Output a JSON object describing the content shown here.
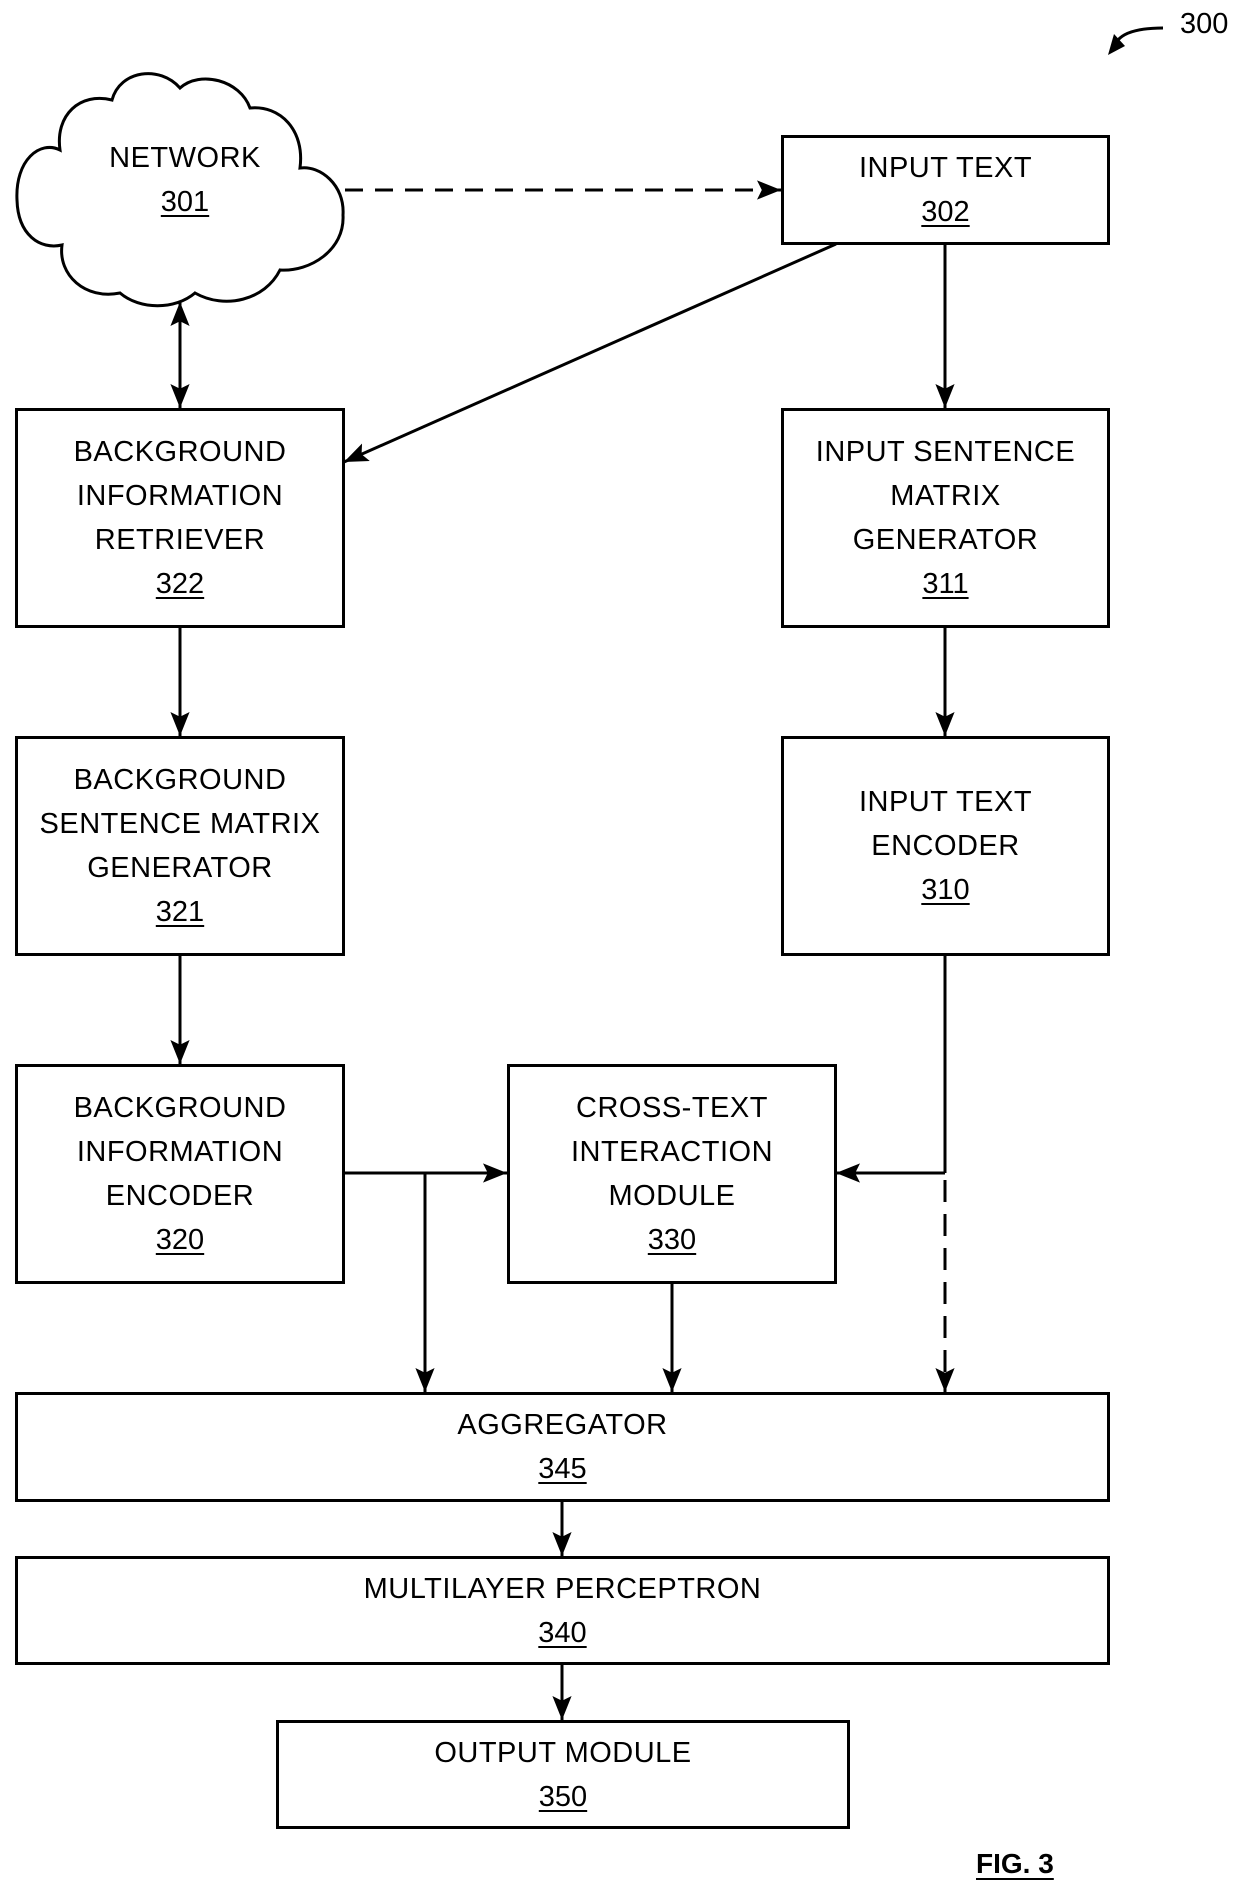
{
  "figure": {
    "reference_number": "300",
    "caption": "FIG. 3"
  },
  "nodes": {
    "network": {
      "label": "NETWORK",
      "ref": "301",
      "shape": "cloud"
    },
    "input_text": {
      "label": "INPUT TEXT",
      "ref": "302"
    },
    "background_information_retriever": {
      "label": "BACKGROUND\nINFORMATION\nRETRIEVER",
      "ref": "322"
    },
    "input_sentence_matrix_generator": {
      "label": "INPUT SENTENCE\nMATRIX\nGENERATOR",
      "ref": "311"
    },
    "background_sentence_matrix_generator": {
      "label": "BACKGROUND\nSENTENCE MATRIX\nGENERATOR",
      "ref": "321"
    },
    "input_text_encoder": {
      "label": "INPUT TEXT\nENCODER",
      "ref": "310"
    },
    "background_information_encoder": {
      "label": "BACKGROUND\nINFORMATION\nENCODER",
      "ref": "320"
    },
    "cross_text_interaction_module": {
      "label": "CROSS-TEXT\nINTERACTION\nMODULE",
      "ref": "330"
    },
    "aggregator": {
      "label": "AGGREGATOR",
      "ref": "345"
    },
    "multilayer_perceptron": {
      "label": "MULTILAYER PERCEPTRON",
      "ref": "340"
    },
    "output_module": {
      "label": "OUTPUT MODULE",
      "ref": "350"
    }
  },
  "edges": [
    {
      "from": "301",
      "to": "302",
      "style": "dashed"
    },
    {
      "from": "301",
      "to": "322",
      "style": "solid",
      "bidirectional": true
    },
    {
      "from": "302",
      "to": "322",
      "style": "solid"
    },
    {
      "from": "302",
      "to": "311",
      "style": "solid"
    },
    {
      "from": "322",
      "to": "321",
      "style": "solid"
    },
    {
      "from": "311",
      "to": "310",
      "style": "solid"
    },
    {
      "from": "321",
      "to": "320",
      "style": "solid"
    },
    {
      "from": "320",
      "to": "330",
      "style": "solid"
    },
    {
      "from": "320",
      "to": "345",
      "style": "solid"
    },
    {
      "from": "310",
      "to": "330",
      "style": "solid"
    },
    {
      "from": "310",
      "to": "345",
      "style": "dashed"
    },
    {
      "from": "330",
      "to": "345",
      "style": "solid"
    },
    {
      "from": "345",
      "to": "340",
      "style": "solid"
    },
    {
      "from": "340",
      "to": "350",
      "style": "solid"
    }
  ]
}
